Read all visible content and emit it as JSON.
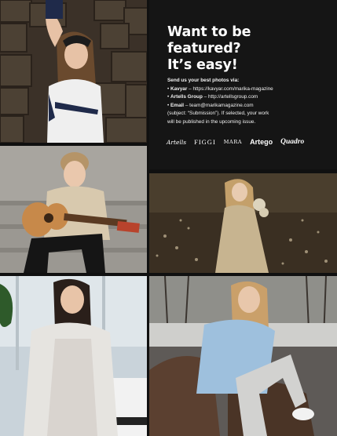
{
  "panel": {
    "headline_lines": [
      "Want to be",
      "featured?",
      "It’s easy!"
    ],
    "lead": "Send us your best photos via:",
    "items": [
      {
        "label": "Kavyar",
        "text": " – https://kavyar.com/marika-magazine"
      },
      {
        "label": "Artells Group",
        "text": " – http://artellsgroup.com"
      },
      {
        "label": "Email",
        "text": " – team@marikamagazine.com"
      }
    ],
    "note_lines": [
      "(subject: “Submission”). If selected, your work",
      "will be published in the upcoming issue."
    ],
    "logos": [
      "Artells",
      "FIGGI",
      "MARA",
      "Artego",
      "Quadro"
    ]
  },
  "photos": [
    {
      "subject": "girl-bandana-stone-wall"
    },
    {
      "subject": "boy-guitar"
    },
    {
      "subject": "girl-field-dress"
    },
    {
      "subject": "girl-fur-vest-piano"
    },
    {
      "subject": "girl-blue-jacket-rocks"
    }
  ],
  "colors": {
    "background": "#101010",
    "panel": "#151515",
    "text": "#ffffff"
  }
}
